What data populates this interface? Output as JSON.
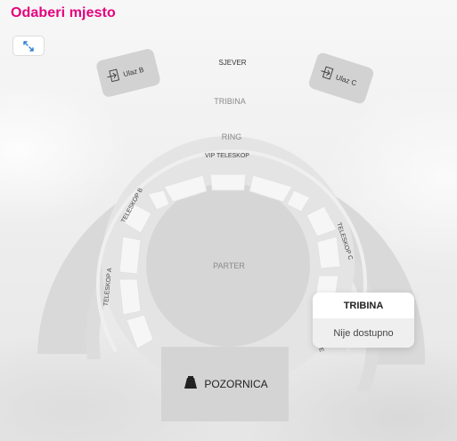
{
  "header": {
    "title": "Odaberi mjesto"
  },
  "toolbar": {
    "expand_icon": "expand-arrows-icon"
  },
  "map": {
    "entrances": [
      {
        "label": "Ulaz B",
        "icon": "entrance-icon"
      },
      {
        "label": "Ulaz C",
        "icon": "entrance-icon"
      }
    ],
    "north_label": "SJEVER",
    "sections": {
      "tribina": "TRIBINA",
      "ring": "RING",
      "vip_teleskop": "VIP TELESKOP",
      "teleskop_b": "TELESKOP B",
      "teleskop_a": "TELESKOP A",
      "teleskop_c": "TELESKOP C",
      "parter": "PARTER",
      "teleskop_d_partial": "TE"
    },
    "stage": {
      "label": "POZORNICA",
      "icon": "stage-light-icon"
    }
  },
  "tooltip": {
    "title": "TRIBINA",
    "status": "Nije dostupno"
  },
  "colors": {
    "brand": "#e6007e",
    "section_fill": "#d9d9d9",
    "seat_block_fill": "#f5f5f5",
    "stage_fill": "#d4d4d4"
  }
}
